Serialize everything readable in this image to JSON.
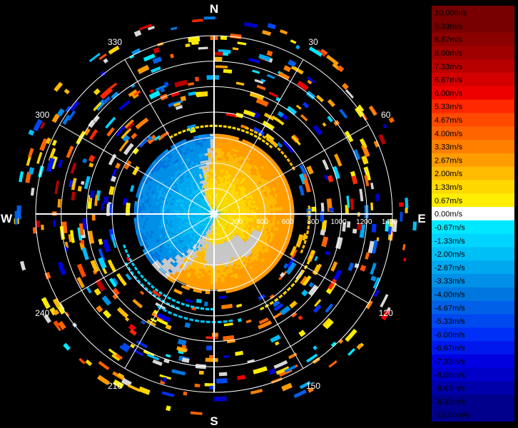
{
  "compass": {
    "north": "N",
    "south": "S",
    "east": "E",
    "west": "W"
  },
  "bearing_labels": [
    {
      "deg": 30,
      "text": "30"
    },
    {
      "deg": 60,
      "text": "60"
    },
    {
      "deg": 120,
      "text": "120"
    },
    {
      "deg": 150,
      "text": "150"
    },
    {
      "deg": 210,
      "text": "210"
    },
    {
      "deg": 240,
      "text": "240"
    },
    {
      "deg": 300,
      "text": "300"
    },
    {
      "deg": 330,
      "text": "330"
    }
  ],
  "range_labels": [
    "200",
    "400",
    "600",
    "800",
    "1000",
    "1200",
    "1400"
  ],
  "range_max": 1400,
  "colors": {
    "background": "#000000",
    "grid": "#ffffff",
    "zero": "#ffffff",
    "positive_scale": [
      "#ffee00",
      "#ffd800",
      "#ffbb00",
      "#ff9d00",
      "#ff8000",
      "#ff6400",
      "#ff4a00",
      "#ff2800",
      "#ee0000",
      "#d40000",
      "#b80000",
      "#a00000",
      "#8c0000",
      "#780000"
    ],
    "negative_scale": [
      "#00e8ff",
      "#00d4ff",
      "#00bff6",
      "#00a8f0",
      "#0090e8",
      "#0078e0",
      "#0060e8",
      "#0048f0",
      "#0030f8",
      "#0018ee",
      "#0000e0",
      "#0000c8",
      "#0000aa",
      "#00008c"
    ],
    "pos_label": [
      "#ffee00",
      "#ffd800",
      "#ffbb00",
      "#ff9d00",
      "#ff8000",
      "#ff6400",
      "#ff4a00",
      "#ff2800",
      "#ee0000",
      "#d40000",
      "#b80000",
      "#a00000",
      "#8c0000",
      "#780000"
    ],
    "neg_label": [
      "#00e8ff",
      "#00d4ff",
      "#00bff6",
      "#00a8f0",
      "#0090e8",
      "#0078e0",
      "#0060e8",
      "#0048f0",
      "#0030f8",
      "#0018ee",
      "#0000e0",
      "#0000c8",
      "#0000aa",
      "#00008c"
    ]
  },
  "legend": {
    "positive": [
      "0.67m/s",
      "1.33m/s",
      "2.00m/s",
      "2.67m/s",
      "3.33m/s",
      "4.00m/s",
      "4.67m/s",
      "5.33m/s",
      "6.00m/s",
      "6.67m/s",
      "7.33m/s",
      "8.00m/s",
      "8.67m/s",
      "9.33m/s",
      "10.00m/s"
    ],
    "zero": "0.00m/s",
    "negative": [
      "-0.67m/s",
      "-1.33m/s",
      "-2.00m/s",
      "-2.67m/s",
      "-3.33m/s",
      "-4.00m/s",
      "-4.67m/s",
      "-5.33m/s",
      "-6.00m/s",
      "-6.67m/s",
      "-7.33m/s",
      "-8.00m/s",
      "-8.67m/s",
      "-9.33m/s",
      "-10.00m/s"
    ]
  }
}
